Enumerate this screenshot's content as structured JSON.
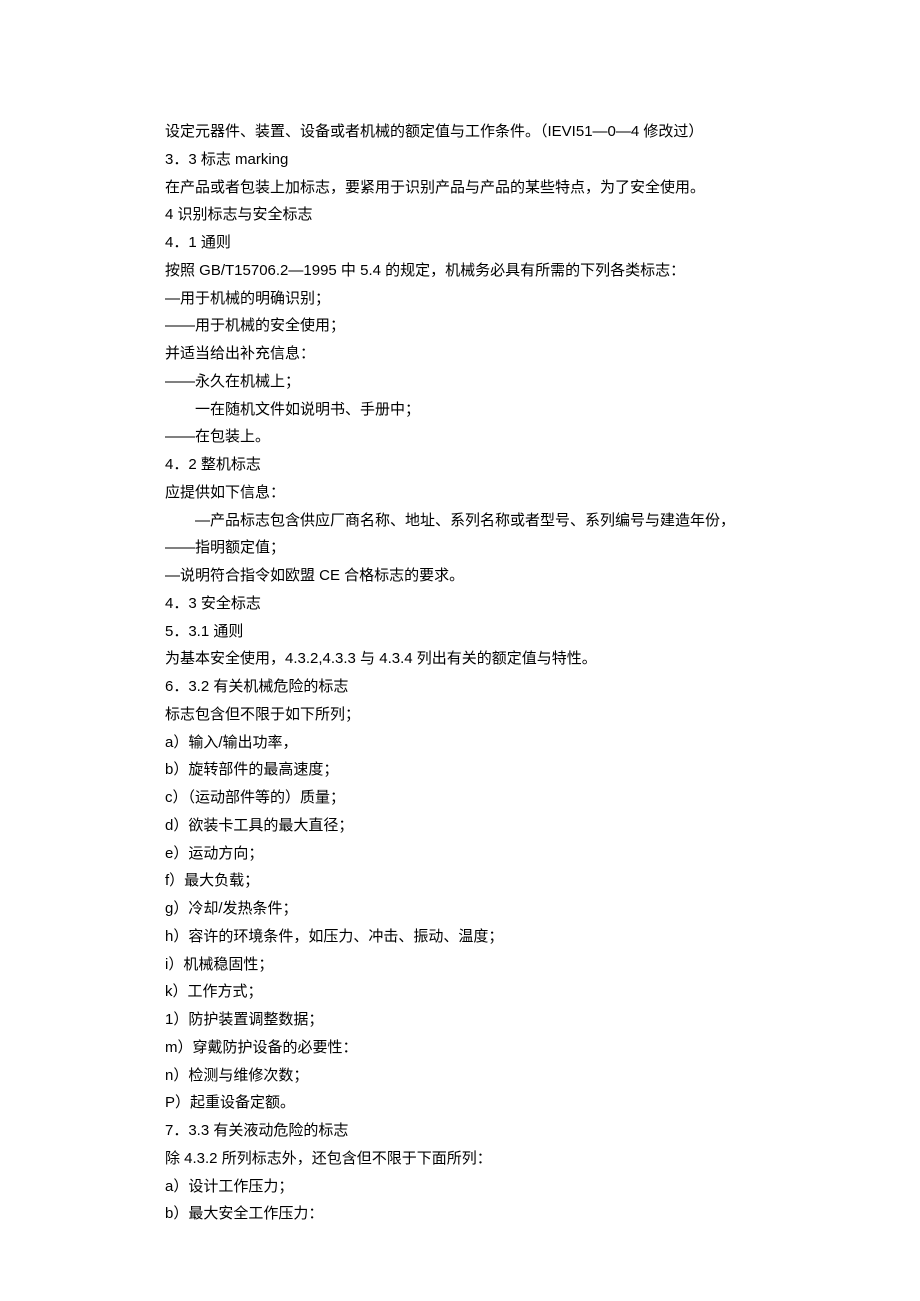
{
  "lines": [
    {
      "text": "设定元器件、装置、设备或者机械的额定值与工作条件。（IEVI51—0—4 修改过）",
      "indent": 0
    },
    {
      "text": "3．3 标志 marking",
      "indent": 0
    },
    {
      "text": "在产品或者包装上加标志，要紧用于识别产品与产品的某些特点，为了安全使用。",
      "indent": 0
    },
    {
      "text": "4 识别标志与安全标志",
      "indent": 0
    },
    {
      "text": "4．1 通则",
      "indent": 0
    },
    {
      "text": "按照 GB/T15706.2—1995 中 5.4 的规定，机械务必具有所需的下列各类标志：",
      "indent": 0
    },
    {
      "text": "—用于机械的明确识别；",
      "indent": 0
    },
    {
      "text": "——用于机械的安全使用；",
      "indent": 0
    },
    {
      "text": "并适当给出补充信息：",
      "indent": 0
    },
    {
      "text": "——永久在机械上；",
      "indent": 0
    },
    {
      "text": "一在随机文件如说明书、手册中；",
      "indent": 1
    },
    {
      "text": "——在包装上。",
      "indent": 0
    },
    {
      "text": "4．2 整机标志",
      "indent": 0
    },
    {
      "text": "应提供如下信息：",
      "indent": 0
    },
    {
      "text": "—产品标志包含供应厂商名称、地址、系列名称或者型号、系列编号与建造年份，",
      "indent": 1
    },
    {
      "text": "——指明额定值；",
      "indent": 0
    },
    {
      "text": "—说明符合指令如欧盟 CE 合格标志的要求。",
      "indent": 0
    },
    {
      "text": "4．3 安全标志",
      "indent": 0
    },
    {
      "text": "5．3.1 通则",
      "indent": 0
    },
    {
      "text": "为基本安全使用，4.3.2,4.3.3 与 4.3.4 列出有关的额定值与特性。",
      "indent": 0
    },
    {
      "text": "6．3.2 有关机械危险的标志",
      "indent": 0
    },
    {
      "text": "标志包含但不限于如下所列；",
      "indent": 0
    },
    {
      "text": "a）输入/输出功率，",
      "indent": 0
    },
    {
      "text": "b）旋转部件的最高速度；",
      "indent": 0
    },
    {
      "text": "c）（运动部件等的）质量；",
      "indent": 0
    },
    {
      "text": "d）欲装卡工具的最大直径；",
      "indent": 0
    },
    {
      "text": "e）运动方向；",
      "indent": 0
    },
    {
      "text": "f）最大负载；",
      "indent": 0
    },
    {
      "text": "g）冷却/发热条件；",
      "indent": 0
    },
    {
      "text": "h）容许的环境条件，如压力、冲击、振动、温度；",
      "indent": 0
    },
    {
      "text": "i）机械稳固性；",
      "indent": 0
    },
    {
      "text": "k）工作方式；",
      "indent": 0
    },
    {
      "text": "1）防护装置调整数据；",
      "indent": 0
    },
    {
      "text": "m）穿戴防护设备的必要性：",
      "indent": 0
    },
    {
      "text": "n）检测与维修次数；",
      "indent": 0
    },
    {
      "text": "P）起重设备定额。",
      "indent": 0
    },
    {
      "text": "7．3.3 有关液动危险的标志",
      "indent": 0
    },
    {
      "text": "除 4.3.2 所列标志外，还包含但不限于下面所列：",
      "indent": 0
    },
    {
      "text": "a）设计工作压力；",
      "indent": 0
    },
    {
      "text": "b）最大安全工作压力：",
      "indent": 0
    }
  ]
}
